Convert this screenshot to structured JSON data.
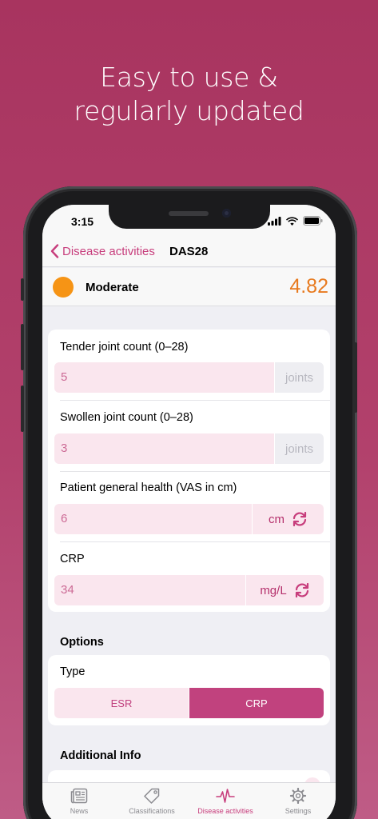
{
  "headline": {
    "line1": "Easy to use &",
    "line2": "regularly updated"
  },
  "status_bar": {
    "time": "3:15"
  },
  "navbar": {
    "back_label": "Disease activities",
    "title": "DAS28"
  },
  "result": {
    "level": "Moderate",
    "score": "4.82",
    "level_color": "#f69415"
  },
  "fields": [
    {
      "label": "Tender joint count (0–28)",
      "value": "5",
      "unit": "joints"
    },
    {
      "label": "Swollen joint count (0–28)",
      "value": "3",
      "unit": "joints"
    },
    {
      "label": "Patient general health (VAS in cm)",
      "value": "6",
      "unit": "cm"
    },
    {
      "label": "CRP",
      "value": "34",
      "unit": "mg/L"
    }
  ],
  "options": {
    "section_label": "Options",
    "type_label": "Type",
    "segments": [
      "ESR",
      "CRP"
    ],
    "selected": "CRP"
  },
  "additional": {
    "section_label": "Additional Info"
  },
  "tabbar": {
    "tabs": [
      {
        "label": "News",
        "icon": "news-icon"
      },
      {
        "label": "Classifications",
        "icon": "tag-icon"
      },
      {
        "label": "Disease activities",
        "icon": "pulse-icon"
      },
      {
        "label": "Settings",
        "icon": "gear-icon"
      }
    ],
    "active": "Disease activities"
  },
  "colors": {
    "accent": "#c73d7c",
    "background": "#a8345f",
    "score": "#e87a1e"
  }
}
